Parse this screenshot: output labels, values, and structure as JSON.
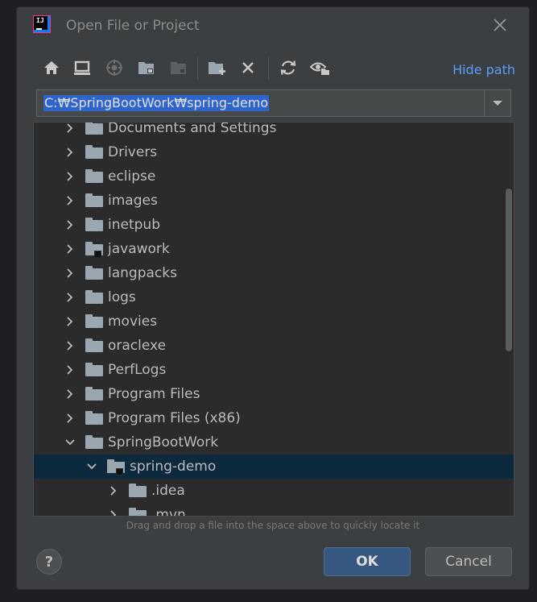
{
  "window": {
    "title": "Open File or Project"
  },
  "toolbar": {
    "buttons": [
      {
        "name": "home-icon"
      },
      {
        "name": "desktop-icon"
      },
      {
        "name": "project-directory-icon"
      },
      {
        "name": "module-directory-icon"
      },
      {
        "name": "folder-icon-disabled"
      },
      {
        "name": "new-folder-icon"
      },
      {
        "name": "delete-icon"
      },
      {
        "name": "refresh-icon"
      },
      {
        "name": "show-hidden-files-icon"
      }
    ],
    "hide_path_label": "Hide path"
  },
  "path": {
    "value": "C:₩SpringBootWork₩spring-demo"
  },
  "tree": {
    "items": [
      {
        "label": "Documents and Settings",
        "level": 0,
        "expanded": false,
        "selected": false,
        "module": false
      },
      {
        "label": "Drivers",
        "level": 0,
        "expanded": false,
        "selected": false,
        "module": false
      },
      {
        "label": "eclipse",
        "level": 0,
        "expanded": false,
        "selected": false,
        "module": false
      },
      {
        "label": "images",
        "level": 0,
        "expanded": false,
        "selected": false,
        "module": false
      },
      {
        "label": "inetpub",
        "level": 0,
        "expanded": false,
        "selected": false,
        "module": false
      },
      {
        "label": "javawork",
        "level": 0,
        "expanded": false,
        "selected": false,
        "module": true
      },
      {
        "label": "langpacks",
        "level": 0,
        "expanded": false,
        "selected": false,
        "module": false
      },
      {
        "label": "logs",
        "level": 0,
        "expanded": false,
        "selected": false,
        "module": false
      },
      {
        "label": "movies",
        "level": 0,
        "expanded": false,
        "selected": false,
        "module": false
      },
      {
        "label": "oraclexe",
        "level": 0,
        "expanded": false,
        "selected": false,
        "module": false
      },
      {
        "label": "PerfLogs",
        "level": 0,
        "expanded": false,
        "selected": false,
        "module": false
      },
      {
        "label": "Program Files",
        "level": 0,
        "expanded": false,
        "selected": false,
        "module": false
      },
      {
        "label": "Program Files (x86)",
        "level": 0,
        "expanded": false,
        "selected": false,
        "module": false
      },
      {
        "label": "SpringBootWork",
        "level": 0,
        "expanded": true,
        "selected": false,
        "module": false
      },
      {
        "label": "spring-demo",
        "level": 1,
        "expanded": true,
        "selected": true,
        "module": true
      },
      {
        "label": ".idea",
        "level": 2,
        "expanded": false,
        "selected": false,
        "module": false
      },
      {
        "label": ".mvn",
        "level": 2,
        "expanded": false,
        "selected": false,
        "module": false
      }
    ]
  },
  "hint": "Drag and drop a file into the space above to quickly locate it",
  "buttons": {
    "help": "?",
    "ok": "OK",
    "cancel": "Cancel"
  },
  "colors": {
    "accent_link": "#589df6",
    "selection": "#0d293e",
    "ok_button": "#365880",
    "path_highlight": "#2f65ca"
  }
}
